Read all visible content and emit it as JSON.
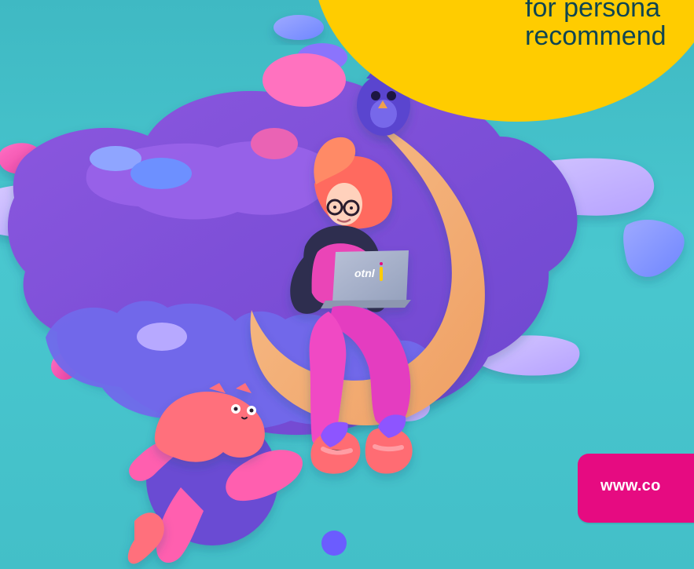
{
  "promo": {
    "headline_line_1": "for persona",
    "headline_line_2": "recommend",
    "website": "www.co"
  },
  "laptop": {
    "brand_text": "otnl"
  },
  "colors": {
    "background": "#45c2cc",
    "bubble": "#ffcc00",
    "cta": "#e60b81",
    "cloud": "#7b4ed6",
    "moon": "#f4b47e",
    "accent_pink": "#f14aa7"
  },
  "icons": [
    "owl-icon",
    "cat-icon",
    "moon-icon",
    "laptop-icon"
  ]
}
